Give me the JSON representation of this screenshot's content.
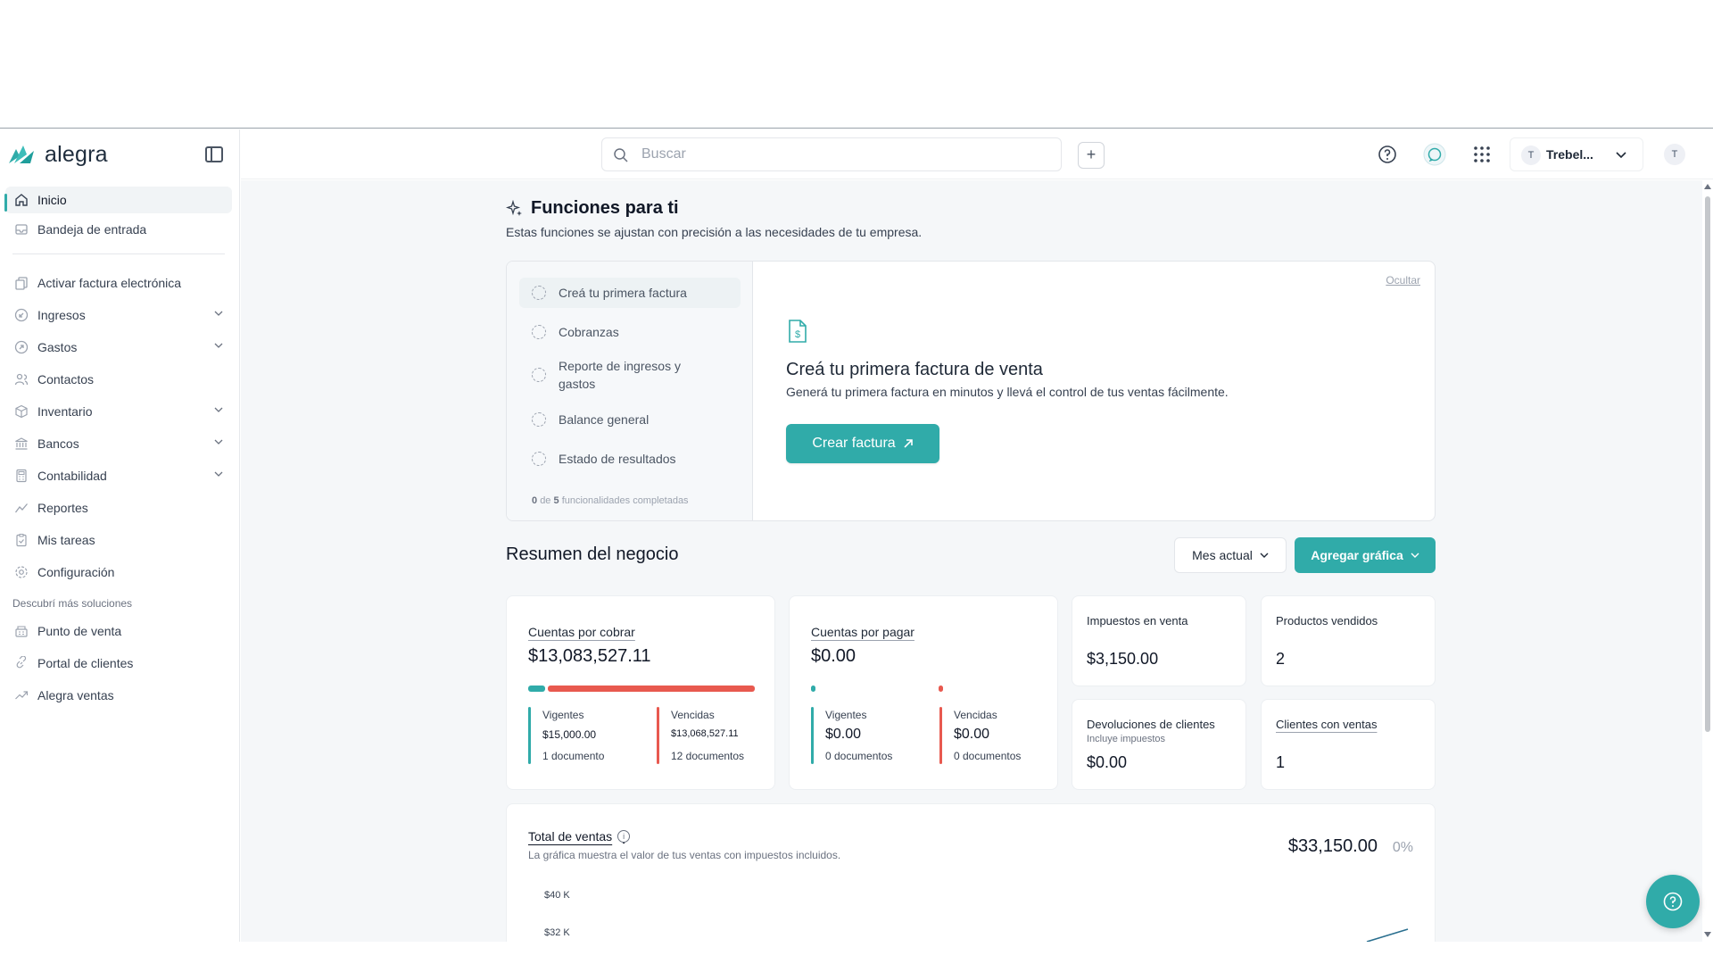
{
  "brand": {
    "name": "alegra",
    "accent": "#30aba9",
    "danger": "#e8594f"
  },
  "sidebar": {
    "items": [
      {
        "label": "Inicio",
        "icon": "home-icon",
        "active": true
      },
      {
        "label": "Bandeja de entrada",
        "icon": "inbox-icon"
      },
      {
        "label": "Activar factura electrónica",
        "icon": "copy-document-icon"
      },
      {
        "label": "Ingresos",
        "icon": "income-icon",
        "expandable": true
      },
      {
        "label": "Gastos",
        "icon": "expense-icon",
        "expandable": true
      },
      {
        "label": "Contactos",
        "icon": "contacts-icon"
      },
      {
        "label": "Inventario",
        "icon": "box-icon",
        "expandable": true
      },
      {
        "label": "Bancos",
        "icon": "bank-icon",
        "expandable": true
      },
      {
        "label": "Contabilidad",
        "icon": "calculator-icon",
        "expandable": true
      },
      {
        "label": "Reportes",
        "icon": "chart-line-icon"
      },
      {
        "label": "Mis tareas",
        "icon": "clipboard-icon"
      },
      {
        "label": "Configuración",
        "icon": "gear-icon"
      }
    ],
    "section_label": "Descubrí más soluciones",
    "solutions": [
      {
        "label": "Punto de venta",
        "icon": "store-icon"
      },
      {
        "label": "Portal de clientes",
        "icon": "link-icon"
      },
      {
        "label": "Alegra ventas",
        "icon": "trend-icon"
      }
    ]
  },
  "header": {
    "search_placeholder": "Buscar",
    "company": "Trebel...",
    "company_initial": "T",
    "user_initial": "T"
  },
  "funciones": {
    "title": "Funciones para ti",
    "subtitle": "Estas funciones se ajustan con precisión a las necesidades de tu empresa.",
    "steps": [
      "Creá tu primera factura",
      "Cobranzas",
      "Reporte de ingresos y gastos",
      "Balance general",
      "Estado de resultados"
    ],
    "progress_done": "0",
    "progress_total": "5",
    "progress_of": "de",
    "progress_suffix": "funcionalidades completadas",
    "hide_label": "Ocultar",
    "panel_title": "Creá tu primera factura de venta",
    "panel_text": "Generá tu primera factura en minutos y llevá el control de tus ventas fácilmente.",
    "cta_label": "Crear factura"
  },
  "resumen": {
    "title": "Resumen del negocio",
    "period_label": "Mes actual",
    "add_chart_label": "Agregar gráfica",
    "cobrar": {
      "title": "Cuentas por cobrar",
      "total": "$13,083,527.11",
      "vigentes_label": "Vigentes",
      "vigentes_amount": "$15,000.00",
      "vigentes_docs": "1 documento",
      "vencidas_label": "Vencidas",
      "vencidas_amount": "$13,068,527.11",
      "vencidas_docs": "12 documentos",
      "vigentes_fraction": 0.0011
    },
    "pagar": {
      "title": "Cuentas por pagar",
      "total": "$0.00",
      "vigentes_label": "Vigentes",
      "vigentes_amount": "$0.00",
      "vigentes_docs": "0 documentos",
      "vencidas_label": "Vencidas",
      "vencidas_amount": "$0.00",
      "vencidas_docs": "0 documentos"
    },
    "impuestos": {
      "title": "Impuestos en venta",
      "value": "$3,150.00"
    },
    "productos": {
      "title": "Productos vendidos",
      "value": "2"
    },
    "devoluciones": {
      "title": "Devoluciones de clientes",
      "note": "Incluye impuestos",
      "value": "$0.00"
    },
    "clientes": {
      "title": "Clientes con ventas",
      "value": "1"
    }
  },
  "ventas": {
    "title": "Total de ventas",
    "subtitle": "La gráfica muestra el valor de tus ventas con impuestos incluidos.",
    "total": "$33,150.00",
    "change": "0%",
    "y_ticks": [
      "$40 K",
      "$32 K"
    ]
  }
}
